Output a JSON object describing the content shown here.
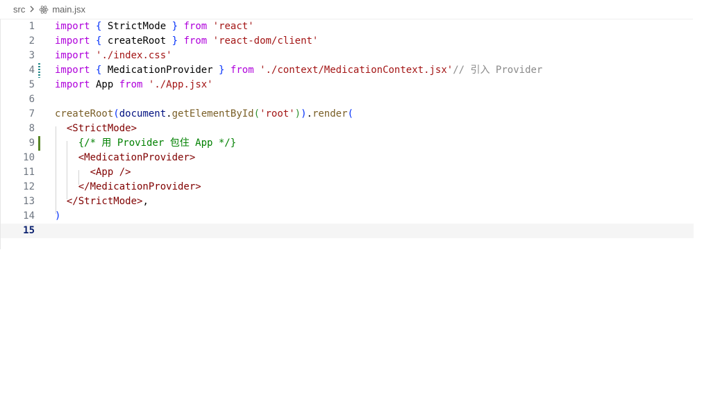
{
  "breadcrumb": {
    "folder": "src",
    "separator": ">",
    "file_icon": "react-icon",
    "file": "main.jsx"
  },
  "editor": {
    "language": "jsx",
    "active_line": 15,
    "lines": [
      {
        "number": "1",
        "tokens": [
          [
            "kw2",
            "import"
          ],
          [
            "plain",
            " "
          ],
          [
            "brk",
            "{"
          ],
          [
            "plain",
            " StrictMode "
          ],
          [
            "brk",
            "}"
          ],
          [
            "plain",
            " "
          ],
          [
            "kw2",
            "from"
          ],
          [
            "plain",
            " "
          ],
          [
            "str",
            "'react'"
          ]
        ]
      },
      {
        "number": "2",
        "tokens": [
          [
            "kw2",
            "import"
          ],
          [
            "plain",
            " "
          ],
          [
            "brk",
            "{"
          ],
          [
            "plain",
            " createRoot "
          ],
          [
            "brk",
            "}"
          ],
          [
            "plain",
            " "
          ],
          [
            "kw2",
            "from"
          ],
          [
            "plain",
            " "
          ],
          [
            "str",
            "'react-dom/client'"
          ]
        ]
      },
      {
        "number": "3",
        "tokens": [
          [
            "kw2",
            "import"
          ],
          [
            "plain",
            " "
          ],
          [
            "str",
            "'./index.css'"
          ]
        ]
      },
      {
        "number": "4",
        "gutter": "modified",
        "tokens": [
          [
            "kw2",
            "import"
          ],
          [
            "plain",
            " "
          ],
          [
            "brk",
            "{"
          ],
          [
            "plain",
            " MedicationProvider "
          ],
          [
            "brk",
            "}"
          ],
          [
            "plain",
            " "
          ],
          [
            "kw2",
            "from"
          ],
          [
            "plain",
            " "
          ],
          [
            "str",
            "'./context/MedicationContext.jsx'"
          ],
          [
            "ghost",
            "// 引入 Provider"
          ]
        ]
      },
      {
        "number": "5",
        "tokens": [
          [
            "kw2",
            "import"
          ],
          [
            "plain",
            " App "
          ],
          [
            "kw2",
            "from"
          ],
          [
            "plain",
            " "
          ],
          [
            "str",
            "'./App.jsx'"
          ]
        ]
      },
      {
        "number": "6",
        "tokens": []
      },
      {
        "number": "7",
        "tokens": [
          [
            "fn",
            "createRoot"
          ],
          [
            "brk",
            "("
          ],
          [
            "var",
            "document"
          ],
          [
            "plain",
            "."
          ],
          [
            "fn",
            "getElementById"
          ],
          [
            "brk2",
            "("
          ],
          [
            "str",
            "'root'"
          ],
          [
            "brk2",
            ")"
          ],
          [
            "brk",
            ")"
          ],
          [
            "plain",
            "."
          ],
          [
            "fn",
            "render"
          ],
          [
            "brk",
            "("
          ]
        ]
      },
      {
        "number": "8",
        "tokens": [
          [
            "plain",
            "  "
          ],
          [
            "tag",
            "<StrictMode>"
          ]
        ]
      },
      {
        "number": "9",
        "gutter": "added",
        "tokens": [
          [
            "plain",
            "    "
          ],
          [
            "cmt",
            "{/* 用 Provider 包住 App */}"
          ]
        ]
      },
      {
        "number": "10",
        "tokens": [
          [
            "plain",
            "    "
          ],
          [
            "tag",
            "<MedicationProvider>"
          ]
        ]
      },
      {
        "number": "11",
        "tokens": [
          [
            "plain",
            "      "
          ],
          [
            "tag",
            "<App />"
          ]
        ]
      },
      {
        "number": "12",
        "tokens": [
          [
            "plain",
            "    "
          ],
          [
            "tag",
            "</MedicationProvider>"
          ]
        ]
      },
      {
        "number": "13",
        "tokens": [
          [
            "plain",
            "  "
          ],
          [
            "tag",
            "</StrictMode>"
          ],
          [
            "plain",
            ","
          ]
        ]
      },
      {
        "number": "14",
        "tokens": [
          [
            "brk",
            ")"
          ]
        ]
      },
      {
        "number": "15",
        "tokens": []
      }
    ]
  }
}
